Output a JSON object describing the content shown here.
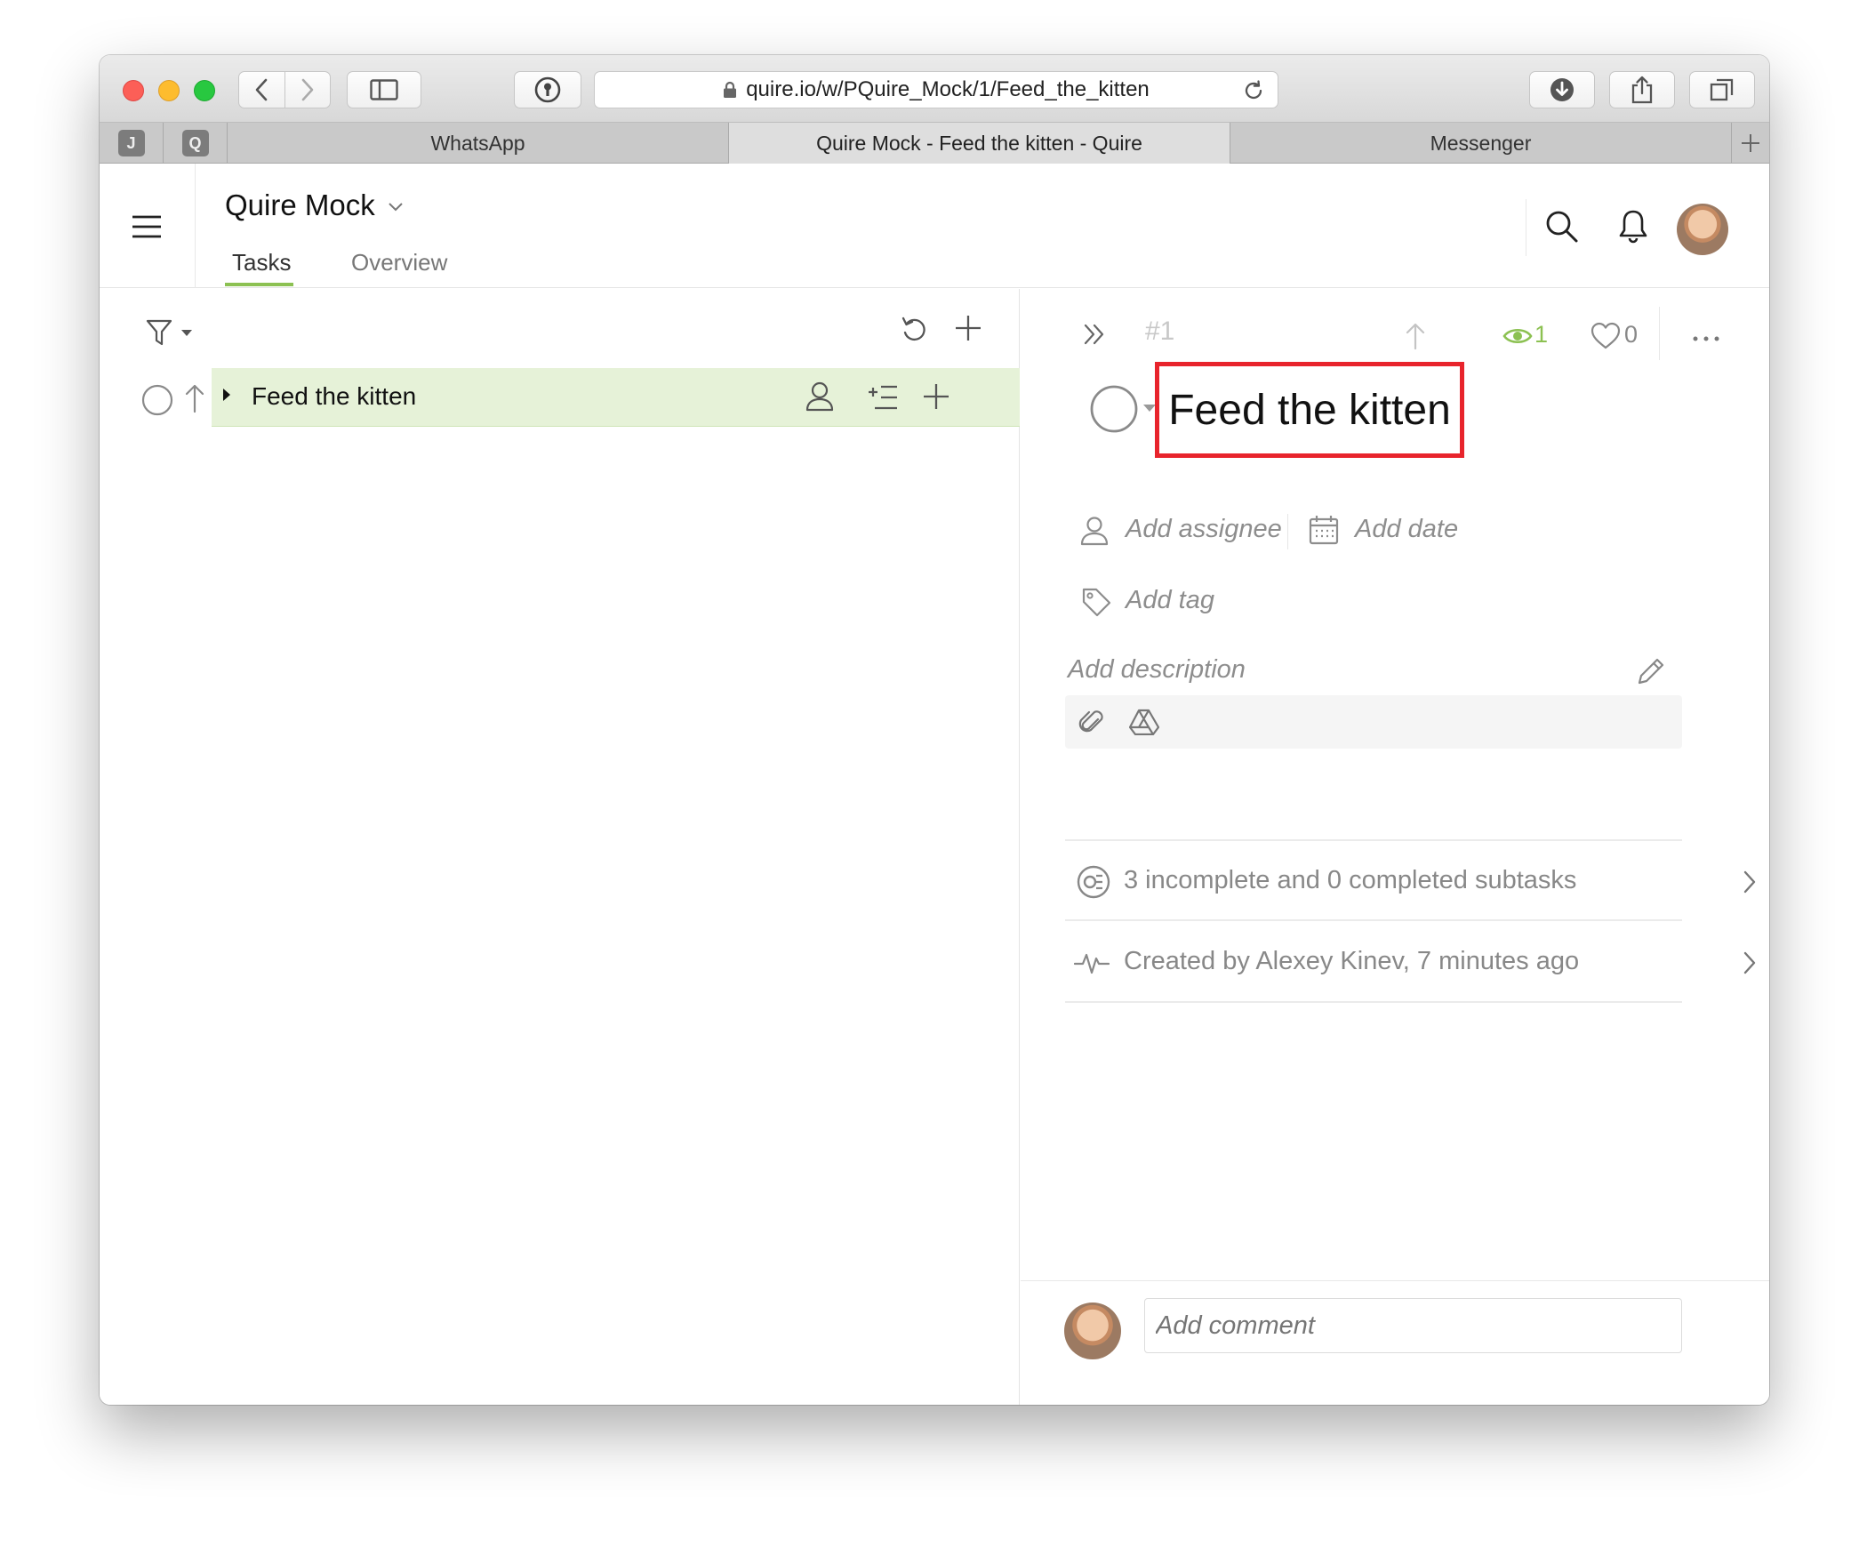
{
  "browser": {
    "url": "quire.io/w/PQuire_Mock/1/Feed_the_kitten",
    "pinned_tabs": [
      {
        "letter": "J"
      },
      {
        "letter": "Q"
      }
    ],
    "tabs": [
      {
        "label": "WhatsApp",
        "active": false
      },
      {
        "label": "Quire Mock - Feed the kitten - Quire",
        "active": true
      },
      {
        "label": "Messenger",
        "active": false
      }
    ]
  },
  "header": {
    "project_title": "Quire Mock",
    "tabs": [
      {
        "label": "Tasks",
        "active": true
      },
      {
        "label": "Overview",
        "active": false
      }
    ]
  },
  "task_list": {
    "tasks": [
      {
        "name": "Feed the kitten",
        "selected": true
      }
    ]
  },
  "detail": {
    "number": "#1",
    "watchers": "1",
    "likes": "0",
    "title": "Feed the kitten",
    "add_assignee": "Add assignee",
    "add_date": "Add date",
    "add_tag": "Add tag",
    "add_description": "Add description",
    "subtasks_summary": "3 incomplete and 0 completed subtasks",
    "activity": "Created by Alexey Kinev, 7 minutes ago",
    "comment_placeholder": "Add comment"
  },
  "colors": {
    "accent": "#8cc152",
    "selection_bg": "#e6f2d8",
    "highlight_box": "#e8242c"
  }
}
